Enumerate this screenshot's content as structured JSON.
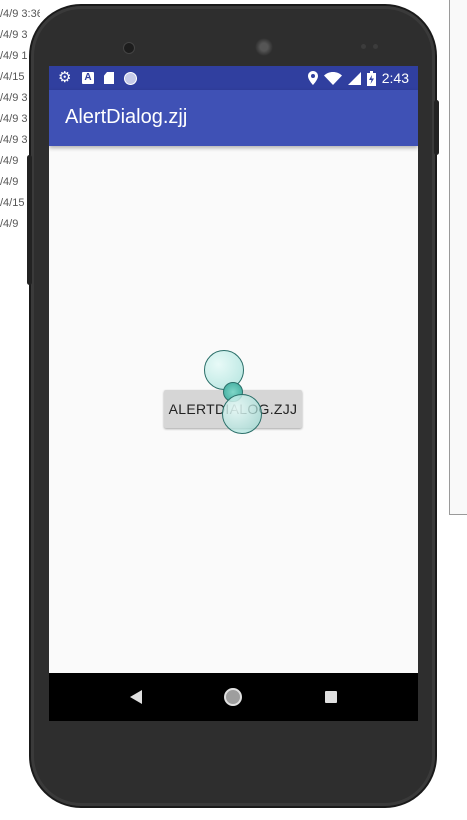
{
  "background_log": {
    "lines": [
      "/4/9 3:36",
      "/4/9 3",
      "/4/9 1",
      "/4/15",
      "/4/9 3",
      "/4/9 3",
      "/4/9 3",
      "/4/9",
      "/4/9",
      "/4/15",
      "/4/9"
    ]
  },
  "status_bar": {
    "time": "2:43",
    "left_icons": [
      "settings-icon",
      "a-icon",
      "sd-card-icon",
      "circle-icon"
    ],
    "right_icons": [
      "location-icon",
      "wifi-icon",
      "signal-icon",
      "battery-charging-icon"
    ]
  },
  "app_bar": {
    "title": "AlertDialog.zjj"
  },
  "main": {
    "button_label": "ALERTDIALOG.ZJJ"
  },
  "nav_bar": {
    "icons": [
      "back-icon",
      "home-icon",
      "recents-icon"
    ]
  },
  "colors": {
    "status_bar": "#303f9f",
    "app_bar": "#3f51b5",
    "screen_background": "#fafafa",
    "button": "#d6d6d6",
    "phone_body": "#2e2e2e"
  }
}
